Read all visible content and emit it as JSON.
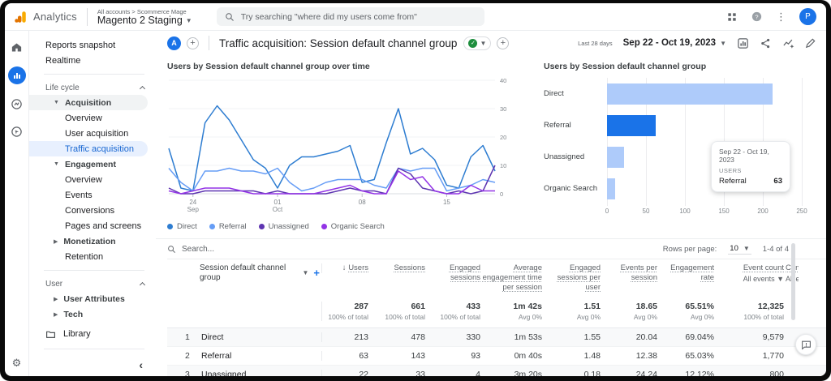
{
  "header": {
    "logo_text": "Analytics",
    "breadcrumb": "All accounts > Scommerce Mage",
    "property": "Magento 2 Staging",
    "search_placeholder": "Try searching \"where did my users come from\"",
    "avatar_initial": "P"
  },
  "sidebar": {
    "reports_snapshot": "Reports snapshot",
    "realtime": "Realtime",
    "lifecycle_label": "Life cycle",
    "acquisition": "Acquisition",
    "acq_overview": "Overview",
    "user_acquisition": "User acquisition",
    "traffic_acquisition": "Traffic acquisition",
    "engagement": "Engagement",
    "eng_overview": "Overview",
    "events": "Events",
    "conversions": "Conversions",
    "pages_screens": "Pages and screens",
    "monetization": "Monetization",
    "retention": "Retention",
    "user_label": "User",
    "user_attributes": "User Attributes",
    "tech": "Tech",
    "library": "Library"
  },
  "report": {
    "workspace_initial": "A",
    "title": "Traffic acquisition: Session default channel group",
    "date_preset": "Last 28 days",
    "date_range": "Sep 22 - Oct 19, 2023"
  },
  "colors": {
    "accent": "#1a73e8",
    "bar_light": "#aecbfa",
    "bar_highlight": "#1a73e8",
    "selected_bg": "#e8f0fe",
    "green_check": "#1e8e3e"
  },
  "chart_data": [
    {
      "type": "line",
      "title": "Users by Session default channel group over time",
      "ylabel": "",
      "ylim": [
        0,
        40
      ],
      "yticks": [
        0,
        10,
        20,
        30,
        40
      ],
      "n_points": 28,
      "x_range": "Sep 22 - Oct 19, 2023",
      "xticks": [
        {
          "index": 2,
          "label": "24",
          "sub": "Sep"
        },
        {
          "index": 9,
          "label": "01",
          "sub": "Oct"
        },
        {
          "index": 16,
          "label": "08",
          "sub": ""
        },
        {
          "index": 23,
          "label": "15",
          "sub": ""
        }
      ],
      "grid": true,
      "legend_position": "bottom",
      "series": [
        {
          "name": "Direct",
          "color": "#2e7dd1",
          "values": [
            16,
            2,
            1,
            25,
            31,
            26,
            19,
            12,
            9,
            2,
            10,
            13,
            13,
            14,
            15,
            17,
            4,
            5,
            18,
            30,
            14,
            16,
            12,
            3,
            2,
            13,
            17,
            8
          ]
        },
        {
          "name": "Referral",
          "color": "#669df6",
          "values": [
            9,
            4,
            1,
            8,
            8,
            9,
            8,
            8,
            7,
            9,
            4,
            1,
            2,
            4,
            5,
            5,
            5,
            3,
            2,
            9,
            8,
            9,
            9,
            1,
            2,
            3,
            5,
            4
          ]
        },
        {
          "name": "Unassigned",
          "color": "#5e35b1",
          "values": [
            2,
            0,
            0,
            1,
            1,
            1,
            1,
            1,
            0,
            1,
            0,
            0,
            0,
            0,
            1,
            2,
            1,
            1,
            0,
            9,
            7,
            2,
            1,
            0,
            1,
            0,
            1,
            10
          ]
        },
        {
          "name": "Organic Search",
          "color": "#9334e6",
          "values": [
            1,
            0,
            1,
            2,
            2,
            2,
            1,
            0,
            0,
            0,
            0,
            0,
            0,
            1,
            2,
            3,
            1,
            0,
            0,
            8,
            5,
            6,
            1,
            0,
            0,
            3,
            1,
            1
          ]
        }
      ]
    },
    {
      "type": "bar",
      "title": "Users by Session default channel group",
      "orientation": "horizontal",
      "categories": [
        "Direct",
        "Referral",
        "Unassigned",
        "Organic Search"
      ],
      "values": [
        213,
        63,
        22,
        10
      ],
      "xlim": [
        0,
        250
      ],
      "xticks": [
        0,
        50,
        100,
        150,
        200,
        250
      ],
      "bar_colors": [
        "#aecbfa",
        "#1a73e8",
        "#aecbfa",
        "#aecbfa"
      ],
      "highlighted": "Referral"
    }
  ],
  "tooltip": {
    "date": "Sep 22 - Oct 19, 2023",
    "metric": "USERS",
    "label": "Referral",
    "value": "63"
  },
  "table": {
    "search_placeholder": "Search...",
    "rows_per_page_label": "Rows per page:",
    "rows_per_page_value": "10",
    "pagination": "1-4 of 4",
    "dimension_column": "Session default channel group",
    "columns": [
      {
        "label": "Users",
        "sorted": true
      },
      {
        "label": "Sessions"
      },
      {
        "label": "Engaged sessions"
      },
      {
        "label": "Average engagement time per session"
      },
      {
        "label": "Engaged sessions per user"
      },
      {
        "label": "Events per session"
      },
      {
        "label": "Engagement rate"
      },
      {
        "label": "Event count",
        "sub": "All events"
      },
      {
        "label": "Conversions",
        "sub": "All events",
        "clipped": true
      }
    ],
    "totals": {
      "values": [
        "287",
        "661",
        "433",
        "1m 42s",
        "1.51",
        "18.65",
        "65.51%",
        "12,325"
      ],
      "subs": [
        "100% of total",
        "100% of total",
        "100% of total",
        "Avg 0%",
        "Avg 0%",
        "Avg 0%",
        "Avg 0%",
        "100% of total"
      ]
    },
    "rows": [
      {
        "num": "1",
        "name": "Direct",
        "values": [
          "213",
          "478",
          "330",
          "1m 53s",
          "1.55",
          "20.04",
          "69.04%",
          "9,579"
        ]
      },
      {
        "num": "2",
        "name": "Referral",
        "values": [
          "63",
          "143",
          "93",
          "0m 40s",
          "1.48",
          "12.38",
          "65.03%",
          "1,770"
        ]
      },
      {
        "num": "3",
        "name": "Unassigned",
        "values": [
          "22",
          "33",
          "4",
          "3m 20s",
          "0.18",
          "24.24",
          "12.12%",
          "800"
        ]
      }
    ]
  }
}
